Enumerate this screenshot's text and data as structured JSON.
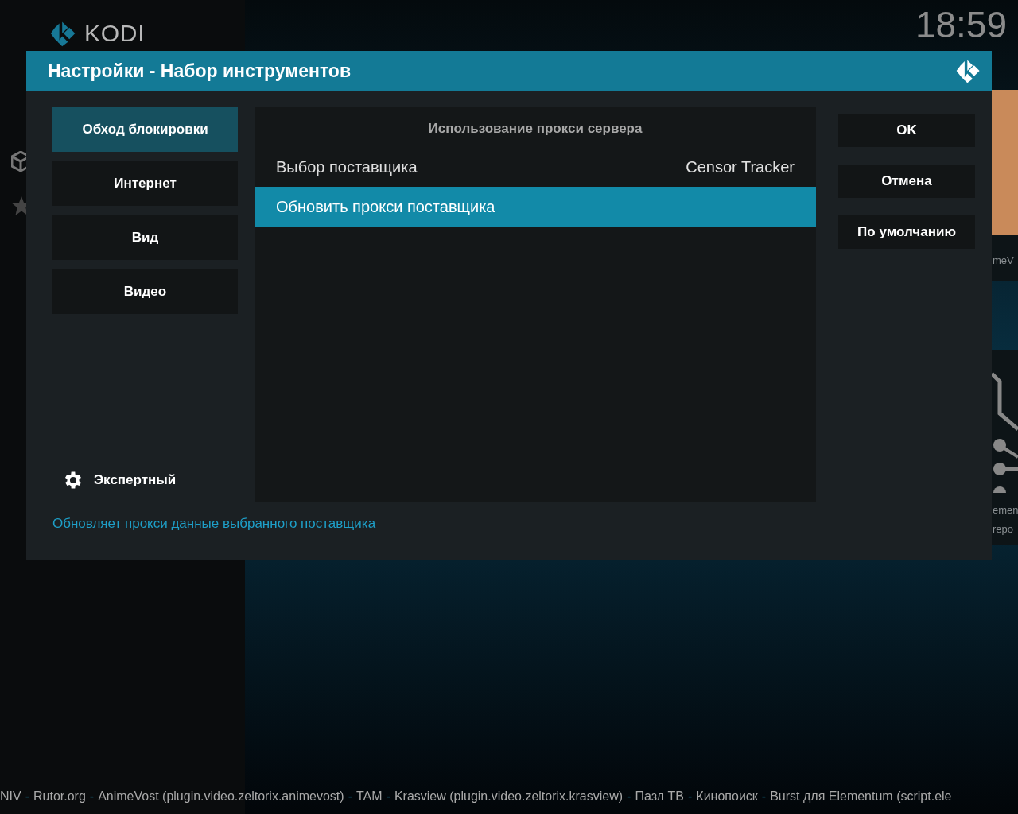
{
  "app": {
    "logo_text": "KODI",
    "clock": "18:59"
  },
  "background_tiles": [
    {
      "kind": "image",
      "lines": [
        "meV"
      ]
    },
    {
      "kind": "network",
      "lines": [
        "emen",
        "repo"
      ]
    }
  ],
  "dialog": {
    "title": "Настройки - Набор инструментов",
    "categories": [
      {
        "label": "Обход блокировки",
        "selected": true
      },
      {
        "label": "Интернет",
        "selected": false
      },
      {
        "label": "Вид",
        "selected": false
      },
      {
        "label": "Видео",
        "selected": false
      }
    ],
    "level_button": {
      "label": "Экспертный"
    },
    "section_title": "Использование прокси сервера",
    "settings": [
      {
        "label": "Выбор поставщика",
        "value": "Censor Tracker",
        "selected": false
      },
      {
        "label": "Обновить прокси поставщика",
        "selected": true
      }
    ],
    "buttons": [
      "OK",
      "Отмена",
      "По умолчанию"
    ],
    "description": "Обновляет прокси данные выбранного поставщика"
  },
  "ticker": {
    "separator": "-",
    "items": [
      "NIV",
      "Rutor.org",
      "AnimeVost (plugin.video.zeltorix.animevost)",
      "TAM",
      "Krasview (plugin.video.zeltorix.krasview)",
      "Пазл ТВ",
      "Кинопоиск",
      "Burst для Elementum (script.ele"
    ]
  }
}
